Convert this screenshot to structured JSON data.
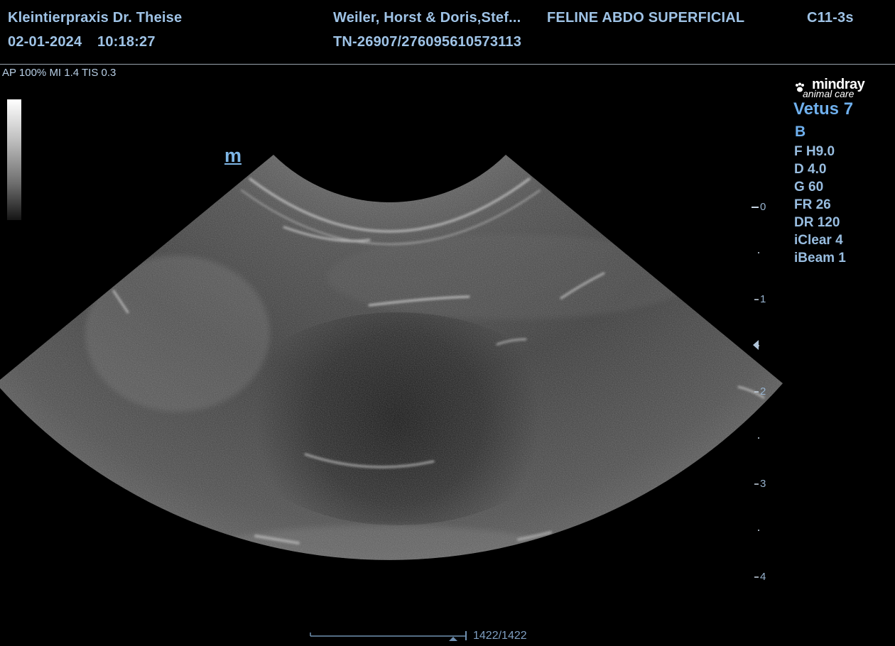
{
  "header": {
    "clinic": "Kleintierpraxis Dr. Theise",
    "date": "02-01-2024",
    "time": "10:18:27",
    "patient": "Weiler, Horst & Doris,Stef...",
    "patient_id": "TN-26907/276095610573113",
    "exam_preset": "FELINE ABDO SUPERFICIAL",
    "probe": "C11-3s"
  },
  "acoustic_output": "AP 100%  MI 1.4 TIS 0.3",
  "orientation_marker": "m",
  "brand": {
    "name": "mindray",
    "subtitle": "animal care",
    "model": "Vetus 7"
  },
  "imaging_mode": "B",
  "parameters": [
    "F H9.0",
    "D 4.0",
    "G 60",
    "FR 26",
    "DR 120",
    "iClear 4",
    "iBeam 1"
  ],
  "depth_scale": {
    "labels": [
      "0",
      "1",
      "2",
      "3",
      "4"
    ],
    "focus_depth_cm": 1.5,
    "max_depth_cm": 4.0
  },
  "cine": {
    "frame": "1422/1422",
    "position_fraction": 1.0
  },
  "colors": {
    "header_text": "#9fc3e6",
    "accent_blue": "#6fb0ee",
    "background": "#000000"
  }
}
